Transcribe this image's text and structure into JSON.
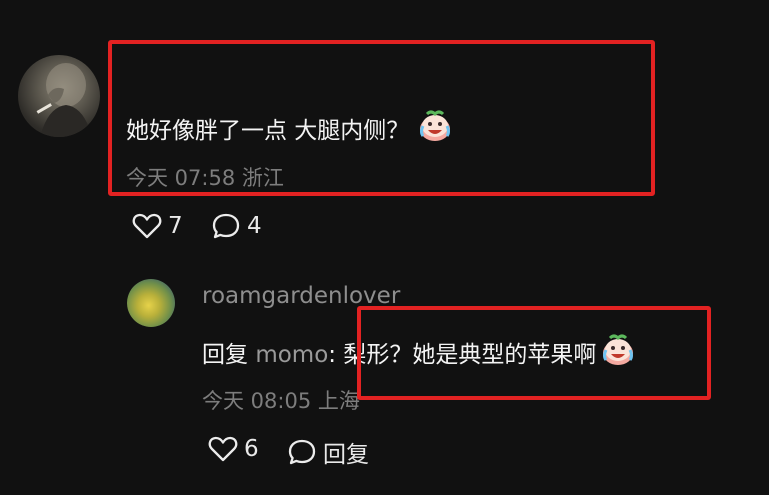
{
  "main_comment": {
    "text": "她好像胖了一点 大腿内侧？",
    "emoji": "crying-laughing-face-icon",
    "time": "今天 07:58",
    "location": "浙江",
    "likes": "7",
    "replies": "4"
  },
  "reply": {
    "username": "roamgardenlover",
    "reply_label": "回复",
    "mention": "momo",
    "text": ": 梨形？她是典型的苹果啊",
    "time": "今天 08:05",
    "location": "上海",
    "likes": "6",
    "reply_action": "回复"
  },
  "colors": {
    "background": "#111111",
    "highlight": "#e32222",
    "meta": "#7d7d7d"
  }
}
